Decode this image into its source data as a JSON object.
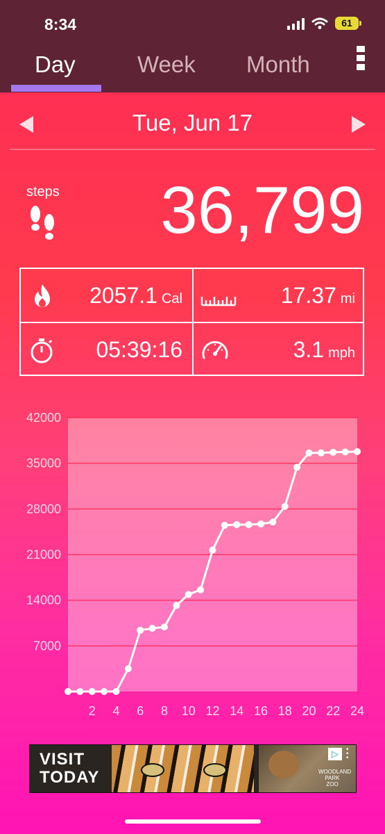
{
  "status_bar": {
    "time": "8:34",
    "battery": "61"
  },
  "tabs": [
    {
      "label": "Day",
      "active": true
    },
    {
      "label": "Week",
      "active": false
    },
    {
      "label": "Month",
      "active": false
    }
  ],
  "date": {
    "label": "Tue, Jun 17"
  },
  "steps": {
    "label": "steps",
    "value": "36,799"
  },
  "stats": {
    "calories": {
      "value": "2057.1",
      "unit": "Cal"
    },
    "distance": {
      "value": "17.37",
      "unit": "mi"
    },
    "duration": {
      "value": "05:39:16"
    },
    "speed": {
      "value": "3.1",
      "unit": "mph"
    }
  },
  "chart_data": {
    "type": "line",
    "title": "",
    "xlabel": "",
    "ylabel": "",
    "x_ticks": [
      "2",
      "4",
      "6",
      "8",
      "10",
      "12",
      "14",
      "16",
      "18",
      "20",
      "22",
      "24"
    ],
    "y_ticks": [
      "42000",
      "35000",
      "28000",
      "21000",
      "14000",
      "7000"
    ],
    "xlim": [
      0,
      24
    ],
    "ylim": [
      0,
      42000
    ],
    "grid": true,
    "series": [
      {
        "x": [
          0,
          1,
          2,
          3,
          4,
          5,
          6,
          7,
          8,
          9,
          10,
          11,
          12,
          13,
          14,
          15,
          16,
          17,
          18,
          19,
          20,
          21,
          22,
          23,
          24
        ],
        "values": [
          0,
          0,
          0,
          0,
          0,
          3500,
          9400,
          9700,
          9900,
          13200,
          14900,
          15600,
          21700,
          25500,
          25600,
          25600,
          25700,
          26000,
          28400,
          34400,
          36600,
          36600,
          36700,
          36750,
          36799
        ]
      }
    ],
    "colors": {
      "line": "#ffffff",
      "area": "rgba(255,255,255,0.35)",
      "grid": "#ff2a55"
    }
  },
  "ad": {
    "line1": "VISIT",
    "line2": "TODAY",
    "sponsor_line1": "WOODLAND",
    "sponsor_line2": "PARK ZOO"
  }
}
